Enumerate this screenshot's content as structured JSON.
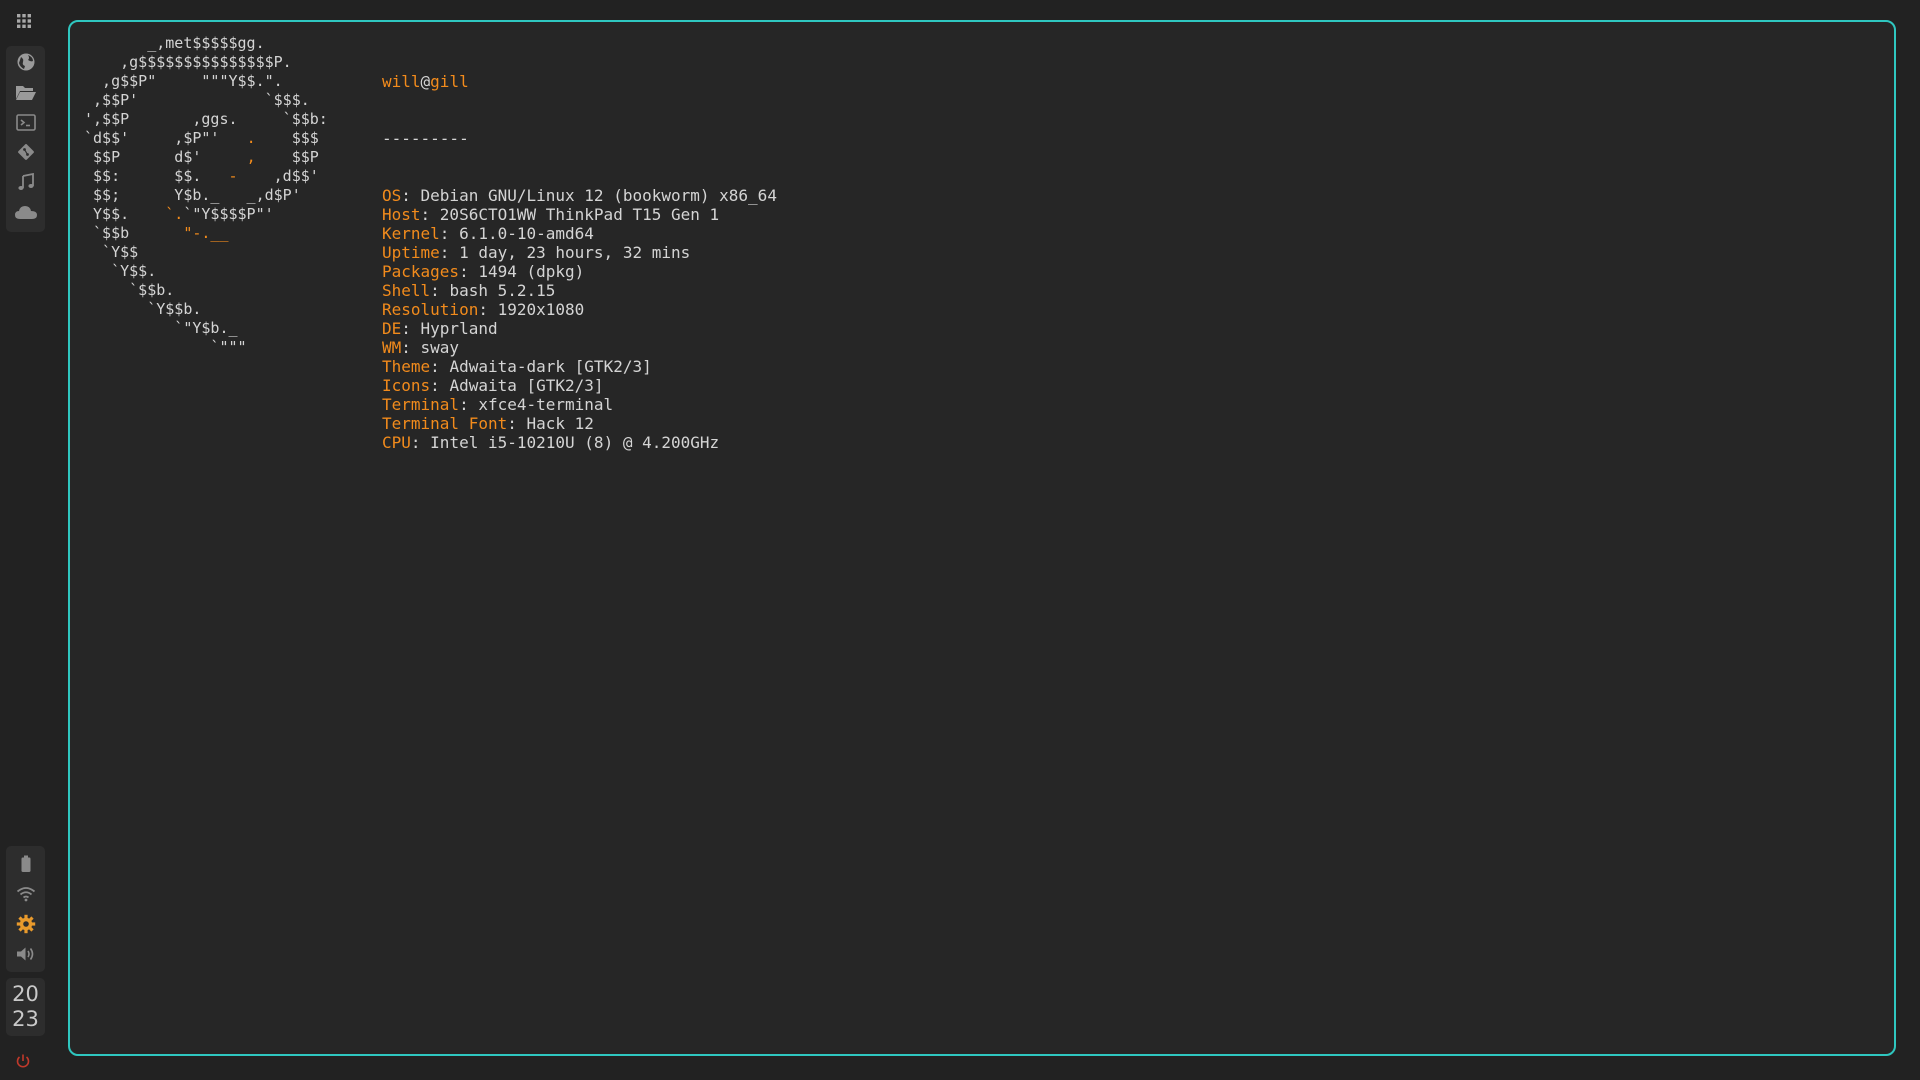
{
  "bar": {
    "launcher_icon": "app-grid-icon",
    "apps": [
      {
        "icon": "globe-icon",
        "label": "browser"
      },
      {
        "icon": "folder-open-icon",
        "label": "files"
      },
      {
        "icon": "terminal-icon",
        "label": "terminal"
      },
      {
        "icon": "git-icon",
        "label": "git"
      },
      {
        "icon": "music-note-icon",
        "label": "music"
      },
      {
        "icon": "cloud-icon",
        "label": "cloud"
      }
    ],
    "system": [
      {
        "icon": "battery-icon"
      },
      {
        "icon": "wifi-icon"
      },
      {
        "icon": "gear-icon"
      },
      {
        "icon": "volume-icon"
      }
    ],
    "clock": {
      "hours": "20",
      "minutes": "23"
    },
    "power_icon": "power-icon",
    "colors": {
      "gear": "#e89a2c",
      "power": "#c0392b",
      "icon": "#8a8a8a"
    }
  },
  "terminal": {
    "border_color": "#2fc7c0",
    "accent_color": "#f28b1c",
    "logo_lines": [
      "       _,met$$$$$gg.",
      "    ,g$$$$$$$$$$$$$$$P.",
      "  ,g$$P\"     \"\"\"Y$$.\".",
      " ,$$P'              `$$$.",
      "',$$P       ,ggs.     `$$b:",
      "`d$$'     ,$P\"'   .    $$$",
      " $$P      d$'     ,    $$P",
      " $$:      $$.   -    ,d$$'",
      " $$;      Y$b._   _,d$P'",
      " Y$$.    `.`\"Y$$$$P\"'",
      " `$$b      \"-.__",
      "  `Y$$",
      "   `Y$$.",
      "     `$$b.",
      "       `Y$$b.",
      "          `\"Y$b._",
      "              `\"\"\""
    ],
    "user": "will",
    "at": "@",
    "host": "gill",
    "separator": "---------",
    "info": [
      {
        "key": "OS",
        "value": "Debian GNU/Linux 12 (bookworm) x86_64"
      },
      {
        "key": "Host",
        "value": "20S6CTO1WW ThinkPad T15 Gen 1"
      },
      {
        "key": "Kernel",
        "value": "6.1.0-10-amd64"
      },
      {
        "key": "Uptime",
        "value": "1 day, 23 hours, 32 mins"
      },
      {
        "key": "Packages",
        "value": "1494 (dpkg)"
      },
      {
        "key": "Shell",
        "value": "bash 5.2.15"
      },
      {
        "key": "Resolution",
        "value": "1920x1080"
      },
      {
        "key": "DE",
        "value": "Hyprland"
      },
      {
        "key": "WM",
        "value": "sway"
      },
      {
        "key": "Theme",
        "value": "Adwaita-dark [GTK2/3]"
      },
      {
        "key": "Icons",
        "value": "Adwaita [GTK2/3]"
      },
      {
        "key": "Terminal",
        "value": "xfce4-terminal"
      },
      {
        "key": "Terminal Font",
        "value": "Hack 12"
      },
      {
        "key": "CPU",
        "value": "Intel i5-10210U (8) @ 4.200GHz"
      }
    ]
  }
}
